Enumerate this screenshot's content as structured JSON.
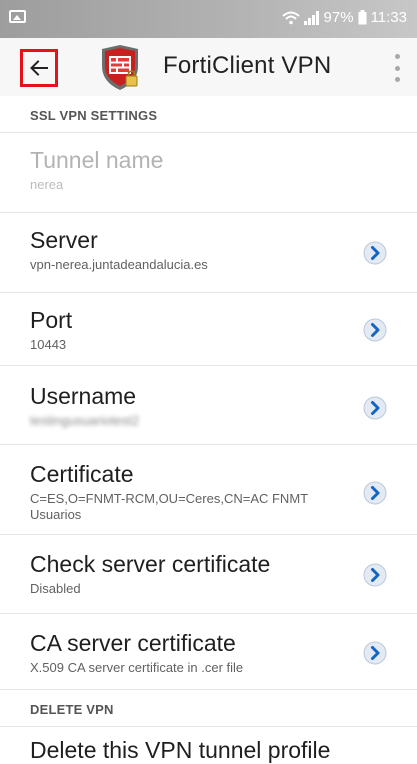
{
  "status_bar": {
    "battery": "97%",
    "time": "11:33",
    "icons": [
      "image-icon",
      "wifi-icon",
      "signal-icon",
      "battery-icon"
    ]
  },
  "app_bar": {
    "title": "FortiClient VPN",
    "back_icon": "arrow-left-icon",
    "menu_icon": "more-vertical-icon",
    "accent": "#e8101a"
  },
  "sections": {
    "ssl_header": "SSL VPN SETTINGS",
    "delete_header": "DELETE VPN"
  },
  "settings": {
    "tunnel_name": {
      "title": "Tunnel name",
      "value": "nerea"
    },
    "server": {
      "title": "Server",
      "value": "vpn-nerea.juntadeandalucia.es"
    },
    "port": {
      "title": "Port",
      "value": "10443"
    },
    "username": {
      "title": "Username",
      "value": "testingusuariotest2"
    },
    "certificate": {
      "title": "Certificate",
      "value": "C=ES,O=FNMT-RCM,OU=Ceres,CN=AC FNMT Usuarios"
    },
    "check_server_cert": {
      "title": "Check server certificate",
      "value": "Disabled"
    },
    "ca_server_cert": {
      "title": "CA server certificate",
      "value": "X.509 CA server certificate in .cer file"
    }
  },
  "delete": {
    "title": "Delete this VPN tunnel profile"
  },
  "colors": {
    "chevron": "#1565c0",
    "chevron_bg": "#e3eaf3"
  }
}
